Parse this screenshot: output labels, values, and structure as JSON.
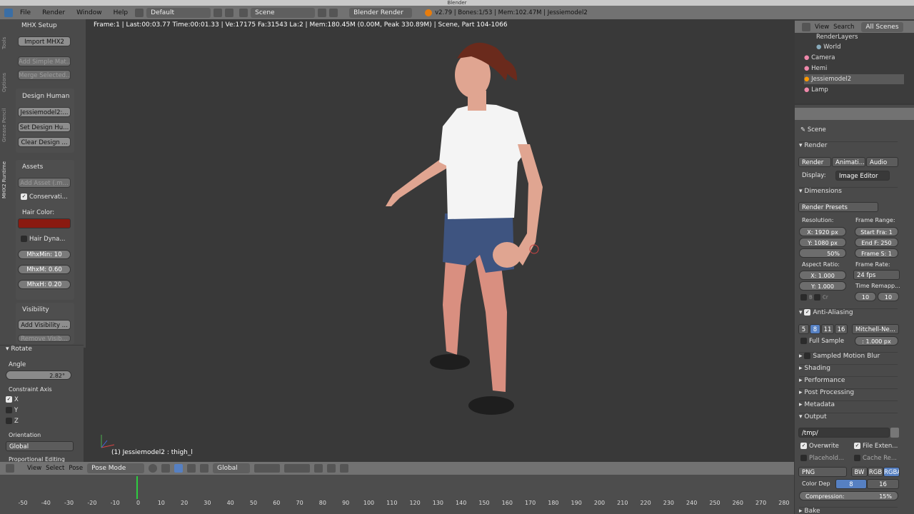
{
  "window": {
    "title": "Blender"
  },
  "topbar": {
    "menus": [
      "File",
      "Render",
      "Window",
      "Help"
    ],
    "layout": "Default",
    "scene": "Scene",
    "engine": "Blender Render",
    "stats": "v2.79 | Bones:1/53 | Mem:102.47M | Jessiemodel2"
  },
  "viewport": {
    "info": "Frame:1 | Last:00:03.77 Time:00:01.33 | Ve:17175 Fa:31543 La:2 | Mem:180.45M (0.00M, Peak 330.89M) | Scene, Part 104-1066",
    "object_label": "(1) Jessiemodel2 : thigh_l"
  },
  "tooltabs": [
    "Tools",
    "Options",
    "Grease Pencil",
    "MHX2 Runtime"
  ],
  "toolshelf": {
    "setup_header": "MHX Setup",
    "import_btn": "Import MHX2",
    "add_simple": "Add Simple Mat...",
    "merge_selected": "Merge Selected...",
    "design_header": "Design Human",
    "design_btns": [
      "Jessiemodel2:...",
      "Set Design Hu...",
      "Clear Design ..."
    ],
    "assets_header": "Assets",
    "add_asset": "Add Asset (.m...",
    "conservative": "Conservati...",
    "hair_color_label": "Hair Color:",
    "hair_color": "#8a1a10",
    "hair_dyn": "Hair Dyna...",
    "mhx_min": "MhxMin:  10",
    "mhx_m": "MhxM: 0.60",
    "mhx_h": "MhxH:  0.20",
    "visibility_header": "Visibility",
    "add_visibility": "Add Visibility ...",
    "remove_visibility": "Remove Visib..."
  },
  "operator": {
    "title": "Rotate",
    "angle_label": "Angle",
    "angle": "2.82°",
    "constraint_label": "Constraint Axis",
    "axes": [
      "X",
      "Y",
      "Z"
    ],
    "orientation_label": "Orientation",
    "orientation": "Global",
    "proportional": "Proportional Editing"
  },
  "outliner": {
    "menus": [
      "View",
      "Search"
    ],
    "filter": "All Scenes",
    "items": [
      "RenderLayers",
      "World",
      "Camera",
      "Hemi",
      "Jessiemodel2",
      "Lamp"
    ]
  },
  "properties": {
    "context": "Scene",
    "render_header": "Render",
    "render_btns": [
      "Render",
      "Animati...",
      "Audio"
    ],
    "display_label": "Display:",
    "display": "Image Editor",
    "dimensions_header": "Dimensions",
    "presets": "Render Presets",
    "resolution_label": "Resolution:",
    "res_x": "X: 1920 px",
    "res_y": "Y: 1080 px",
    "res_pct": "50%",
    "frame_range_label": "Frame Range:",
    "start": "Start Fra: 1",
    "end": "End F: 250",
    "step": "Frame S: 1",
    "aspect_label": "Aspect Ratio:",
    "asp_x": "X:  1.000",
    "asp_y": "Y:  1.000",
    "framerate_label": "Frame Rate:",
    "fps": "24 fps",
    "remap_label": "Time Remapp...",
    "remap_old": "10",
    "remap_new": "10",
    "border": "B",
    "crop": "Cr",
    "aa_header": "Anti-Aliasing",
    "aa_samples": [
      "5",
      "8",
      "11",
      "16"
    ],
    "aa_filter": "Mitchell-Ne...",
    "full_sample": "Full Sample",
    "filter_size": ": 1.000 px",
    "sections": [
      "Sampled Motion Blur",
      "Shading",
      "Performance",
      "Post Processing",
      "Metadata",
      "Output"
    ],
    "output_path": "/tmp/",
    "overwrite": "Overwrite",
    "file_ext": "File Exten...",
    "placeholders": "Placehold...",
    "cache": "Cache Re...",
    "format": "PNG",
    "color_modes": [
      "BW",
      "RGB",
      "RGBA"
    ],
    "color_depth_label": "Color Dep",
    "depth_vals": [
      "8",
      "16"
    ],
    "compression": "Compression:",
    "compression_val": "15%",
    "bake": "Bake"
  },
  "bottom": {
    "menus": [
      "View",
      "Select",
      "Pose"
    ],
    "mode": "Pose Mode",
    "orientation": "Global"
  },
  "timeline": {
    "ticks": [
      "-50",
      "-40",
      "-30",
      "-20",
      "-10",
      "0",
      "10",
      "20",
      "30",
      "40",
      "50",
      "60",
      "70",
      "80",
      "90",
      "100",
      "110",
      "120",
      "130",
      "140",
      "150",
      "160",
      "170",
      "180",
      "190",
      "200",
      "210",
      "220",
      "230",
      "240",
      "250",
      "260",
      "270",
      "280"
    ],
    "current_frame": "1"
  }
}
